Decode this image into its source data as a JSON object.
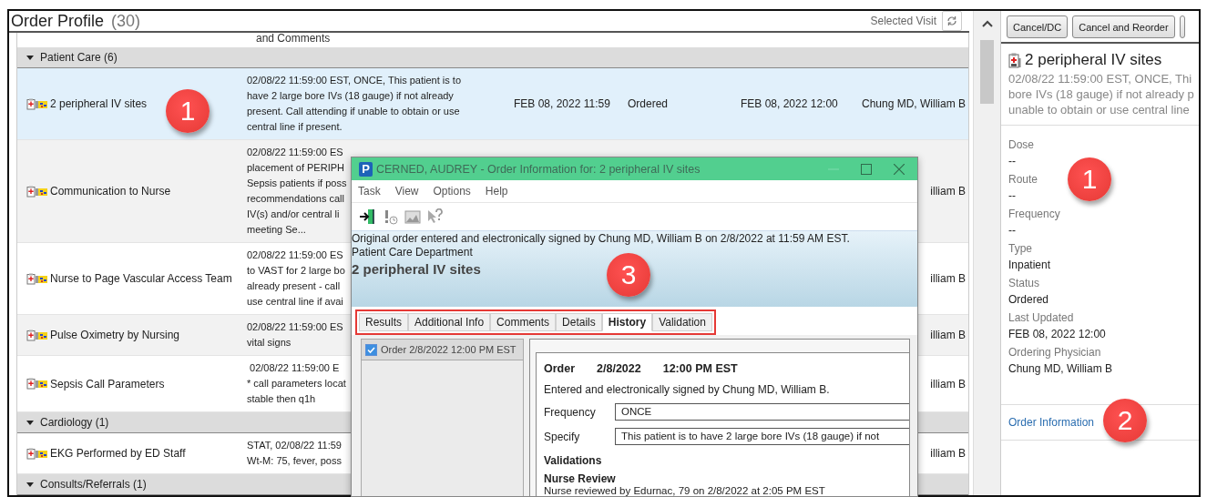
{
  "header": {
    "title": "Order Profile",
    "count": "(30)",
    "visit_filter": "Selected Visit"
  },
  "orders": {
    "partial_top": "and Comments",
    "groups": [
      {
        "name": "Patient Care (6)",
        "expanded": true,
        "rows": [
          {
            "name": "2 peripheral IV sites",
            "selected": true,
            "details": [
              "02/08/22 11:59:00 EST, ONCE, This patient is to",
              "have 2 large bore IVs (18 gauge) if not already",
              "present. Call attending if unable to obtain or use",
              "central line if present."
            ],
            "start": "FEB 08, 2022 11:59",
            "status": "Ordered",
            "updated": "FEB 08, 2022 12:00",
            "physician": "Chung MD, William B"
          },
          {
            "name": "Communication to Nurse",
            "selected": false,
            "details": [
              "02/08/22 11:59:00 ES",
              "placement of PERIPH",
              "Sepsis patients if poss",
              "recommendations call",
              "IV(s) and/or central li",
              "meeting Se..."
            ],
            "physician": "illiam B"
          },
          {
            "name": "Nurse to Page Vascular Access Team",
            "selected": false,
            "details": [
              "02/08/22 11:59:00 ES",
              "to VAST for 2 large bo",
              "already present - call",
              "use central line if avai"
            ],
            "physician": "illiam B"
          },
          {
            "name": "Pulse Oximetry by Nursing",
            "selected": false,
            "details": [
              "02/08/22 11:59:00 ES",
              "vital signs"
            ],
            "physician": "illiam B"
          },
          {
            "name": "Sepsis Call Parameters",
            "selected": false,
            "details": [
              " 02/08/22 11:59:00 E",
              "* call parameters locat",
              "stable then q1h"
            ],
            "physician": "illiam B"
          }
        ]
      },
      {
        "name": "Cardiology (1)",
        "expanded": true,
        "rows": [
          {
            "name": "EKG Performed by ED Staff",
            "selected": false,
            "details": [
              "STAT, 02/08/22 11:59",
              "Wt-M: 75, fever, poss"
            ],
            "physician": "illiam B"
          }
        ]
      },
      {
        "name": "Consults/Referrals (1)",
        "expanded": true
      }
    ]
  },
  "detail": {
    "actions": [
      "Cancel/DC",
      "Cancel and Reorder"
    ],
    "title": "2 peripheral IV sites",
    "summary": [
      "02/08/22 11:59:00 EST, ONCE, Thi",
      "bore IVs (18 gauge) if not already p",
      "unable to obtain or use central line"
    ],
    "fields": [
      {
        "label": "Dose",
        "value": "--"
      },
      {
        "label": "Route",
        "value": "--"
      },
      {
        "label": "Frequency",
        "value": "--"
      },
      {
        "label": "Type",
        "value": "Inpatient"
      },
      {
        "label": "Status",
        "value": "Ordered"
      },
      {
        "label": "Last Updated",
        "value": "FEB 08, 2022 12:00"
      },
      {
        "label": "Ordering Physician",
        "value": "Chung MD, William B"
      }
    ],
    "link": "Order Information"
  },
  "dialog": {
    "app_badge": "P",
    "title": "CERNED, AUDREY - Order Information for: 2 peripheral IV sites",
    "menu": [
      "Task",
      "View",
      "Options",
      "Help"
    ],
    "banner": {
      "signed": "Original order entered and electronically signed by Chung MD, William B on 2/8/2022 at 11:59 AM EST.",
      "department": "Patient Care Department",
      "order_name": "2 peripheral IV sites"
    },
    "tabs_highlighted": true,
    "tabs": [
      {
        "label": "Results",
        "selected": false
      },
      {
        "label": "Additional Info",
        "selected": false
      },
      {
        "label": "Comments",
        "selected": false
      },
      {
        "label": "Details",
        "selected": false
      },
      {
        "label": "History",
        "selected": true
      },
      {
        "label": "Validation",
        "selected": false
      }
    ],
    "history": [
      {
        "label": "Order 2/8/2022 12:00 PM EST",
        "checked": true,
        "selected": true
      }
    ],
    "record": {
      "action": "Order",
      "date": "2/8/2022",
      "time": "12:00 PM EST",
      "signed": "Entered and electronically signed by Chung MD, William B.",
      "fields": [
        {
          "label": "Frequency",
          "value": "ONCE"
        },
        {
          "label": "Specify",
          "value": "This patient is to have 2 large bore IVs (18 gauge) if not"
        }
      ],
      "validations_heading": "Validations",
      "review_heading": "Nurse Review",
      "review_text": "Nurse reviewed by Edurnac, 79 on 2/8/2022 at 2:05 PM EST"
    }
  },
  "callouts": [
    {
      "label": "1"
    },
    {
      "label": "1"
    },
    {
      "label": "2"
    },
    {
      "label": "3"
    }
  ]
}
